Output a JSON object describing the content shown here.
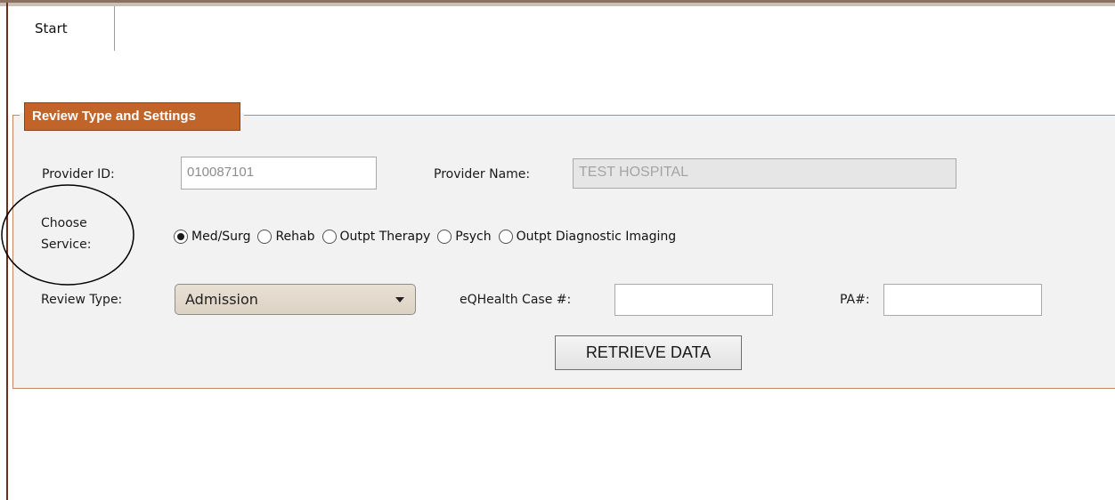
{
  "tabs": [
    {
      "label": "Start"
    }
  ],
  "panel": {
    "legend": "Review Type and Settings"
  },
  "provider_id": {
    "label": "Provider ID:",
    "value": "010087101"
  },
  "provider_name": {
    "label": "Provider Name:",
    "value": "TEST HOSPITAL"
  },
  "service": {
    "label_line1": "Choose",
    "label_line2": "Service:",
    "selected": "Med/Surg",
    "options": [
      {
        "label": "Med/Surg",
        "checked": true
      },
      {
        "label": "Rehab",
        "checked": false
      },
      {
        "label": "Outpt Therapy",
        "checked": false
      },
      {
        "label": "Psych",
        "checked": false
      },
      {
        "label": "Outpt Diagnostic Imaging",
        "checked": false
      }
    ]
  },
  "review_type": {
    "label": "Review Type:",
    "selected": "Admission"
  },
  "case_number": {
    "label": "eQHealth Case #:",
    "value": ""
  },
  "pa_number": {
    "label": "PA#:",
    "value": ""
  },
  "retrieve_button": {
    "label": "RETRIEVE DATA"
  },
  "colors": {
    "legend_bg": "#c0642a",
    "panel_border": "#c08860",
    "panel_bg": "#f2f2f2"
  }
}
